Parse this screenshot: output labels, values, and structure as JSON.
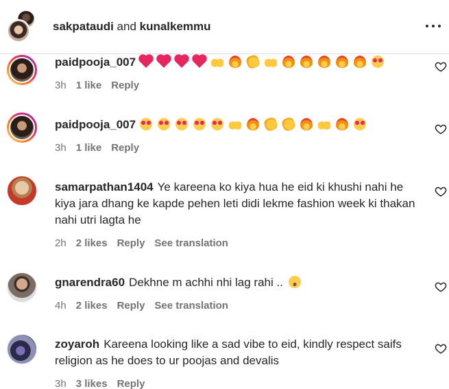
{
  "header": {
    "user1": "sakpataudi",
    "connector": " and ",
    "user2": "kunalkemmu"
  },
  "comments": [
    {
      "username": "paidpooja_007",
      "text": "",
      "emojis": [
        "heart",
        "heart",
        "heart",
        "heart",
        "raise",
        "fire",
        "clap",
        "raise",
        "fire",
        "fire",
        "fire",
        "fire",
        "fire",
        "heart-eyes"
      ],
      "time": "3h",
      "likes": "1 like",
      "reply": "Reply"
    },
    {
      "username": "paidpooja_007",
      "text": "",
      "emojis": [
        "heart-eyes",
        "heart-eyes",
        "heart-eyes",
        "heart-eyes",
        "heart-eyes",
        "raise",
        "fire",
        "clap",
        "clap",
        "fire",
        "raise",
        "fire",
        "heart-eyes"
      ],
      "time": "3h",
      "likes": "1 like",
      "reply": "Reply"
    },
    {
      "username": "samarpathan1404",
      "text": "Ye kareena ko kiya hua he eid ki khushi nahi he kiya jara dhang ke kapde pehen leti didi lekme fashion week ki thakan nahi utri lagta he",
      "time": "2h",
      "likes": "2 likes",
      "reply": "Reply",
      "translate": "See translation"
    },
    {
      "username": "gnarendra60",
      "text": "Dekhne m achhi nhi lag rahi ..",
      "trailing_emoji": "astonished",
      "time": "4h",
      "likes": "2 likes",
      "reply": "Reply",
      "translate": "See translation"
    },
    {
      "username": "zoyaroh",
      "text": "Kareena looking like a sad vibe to eid, kindly respect saifs religion as he does to ur poojas and devalis",
      "time": "3h",
      "likes": "3 likes",
      "reply": "Reply"
    }
  ]
}
